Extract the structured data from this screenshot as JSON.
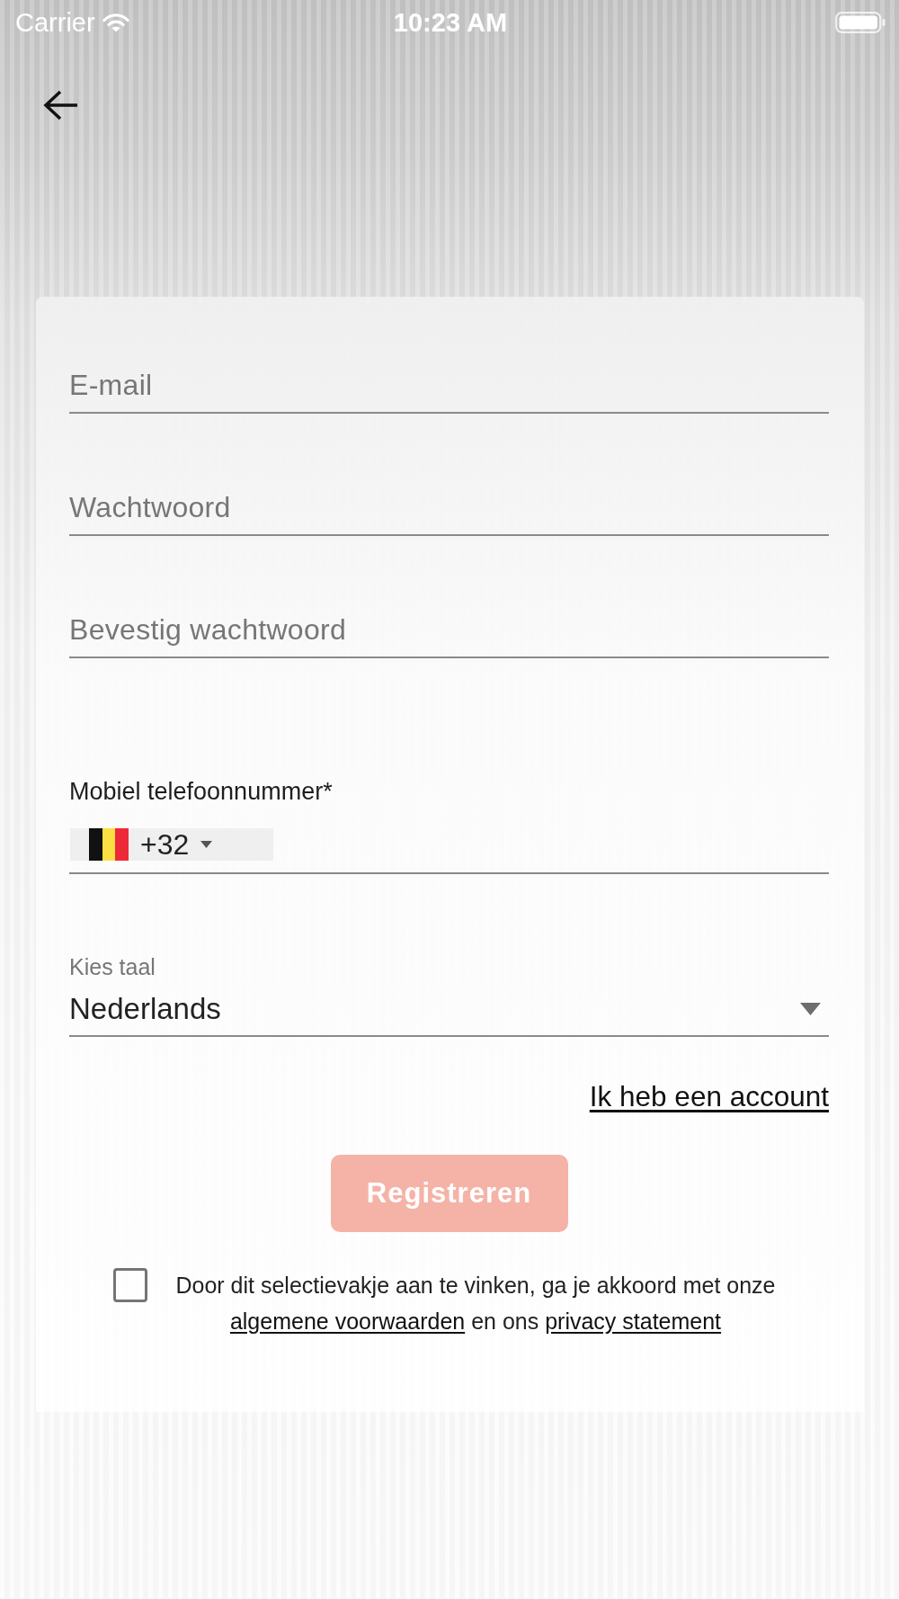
{
  "status_bar": {
    "carrier": "Carrier",
    "time": "10:23 AM"
  },
  "form": {
    "fields": [
      {
        "placeholder": "E-mail"
      },
      {
        "placeholder": "Wachtwoord"
      },
      {
        "placeholder": "Bevestig wachtwoord"
      }
    ],
    "phone": {
      "label": "Mobiel telefoonnummer*",
      "country_code": "+32"
    },
    "language": {
      "label": "Kies taal",
      "value": "Nederlands"
    },
    "login_link": "Ik heb een account",
    "register_button": {
      "label": "Registreren",
      "disabled": true
    },
    "terms": {
      "checked": false,
      "parts": [
        {
          "kind": "text",
          "text": "Door dit selectievakje aan te vinken, ga je akkoord met onze"
        },
        {
          "kind": "link",
          "text": "algemene voorwaarden"
        },
        {
          "kind": "text",
          "text": "en ons"
        },
        {
          "kind": "link",
          "text": "privacy statement"
        }
      ]
    }
  }
}
